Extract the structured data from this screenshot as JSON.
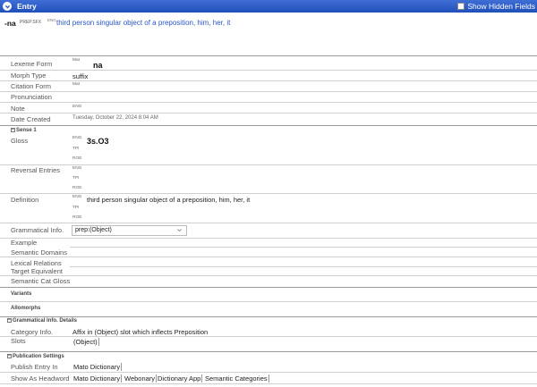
{
  "header": {
    "title": "Entry",
    "show_hidden_label": "Show Hidden Fields",
    "show_hidden_checked": false
  },
  "summary": {
    "lexeme": "-na",
    "gram": "PREP.SFX",
    "ws": "ENG",
    "definition": "third person singular object of a preposition, him, her, it"
  },
  "fields": {
    "lexeme_form_label": "Lexeme Form",
    "lexeme_form_ws": "Mat",
    "lexeme_form_value": "na",
    "morph_type_label": "Morph Type",
    "morph_type_value": "suffix",
    "citation_form_label": "Citation Form",
    "citation_form_ws": "Mat",
    "pronunciation_label": "Pronunciation",
    "note_label": "Note",
    "note_ws": "ENG",
    "date_created_label": "Date Created",
    "date_created_value": "Tuesday, October 22, 2024 8:04 AM"
  },
  "sense": {
    "section_label": "Sense 1",
    "gloss_label": "Gloss",
    "gloss_ws": [
      "ENG",
      "TPI",
      "ROE"
    ],
    "gloss_value": "3s.O3",
    "reversal_label": "Reversal Entries",
    "reversal_ws": [
      "ENG",
      "TPI",
      "ROE"
    ],
    "definition_label": "Definition",
    "definition_ws": [
      "ENG",
      "TPI",
      "ROE"
    ],
    "definition_value": "third person singular object of a preposition, him, her, it",
    "gram_info_label": "Grammatical Info.",
    "gram_info_value": "prep:(Object)",
    "example_label": "Example",
    "semantic_domains_label": "Semantic Domains",
    "lexical_relations_label": "Lexical Relations",
    "target_equivalent_label": "Target Equivalent",
    "semantic_cat_gloss_label": "Semantic Cat Gloss"
  },
  "groups": {
    "variants_label": "Variants",
    "allomorphs_label": "Allomorphs"
  },
  "gram_details": {
    "section_label": "Grammatical Info. Details",
    "category_label": "Category Info.",
    "category_value": "Affix in (Object) slot which inflects Preposition",
    "slots_label": "Slots",
    "slots_value": "(Object)"
  },
  "publication": {
    "section_label": "Publication Settings",
    "publish_in_label": "Publish Entry In",
    "publish_in_value": "Mato Dictionary",
    "headword_label": "Show As Headword",
    "headword_values": [
      "Mato Dictionary",
      "Webonary",
      "Dictionary App",
      "Semantic Categories"
    ]
  },
  "colors": {
    "titlebar": "#1f4fb8",
    "definition_link": "#2a56c6"
  }
}
